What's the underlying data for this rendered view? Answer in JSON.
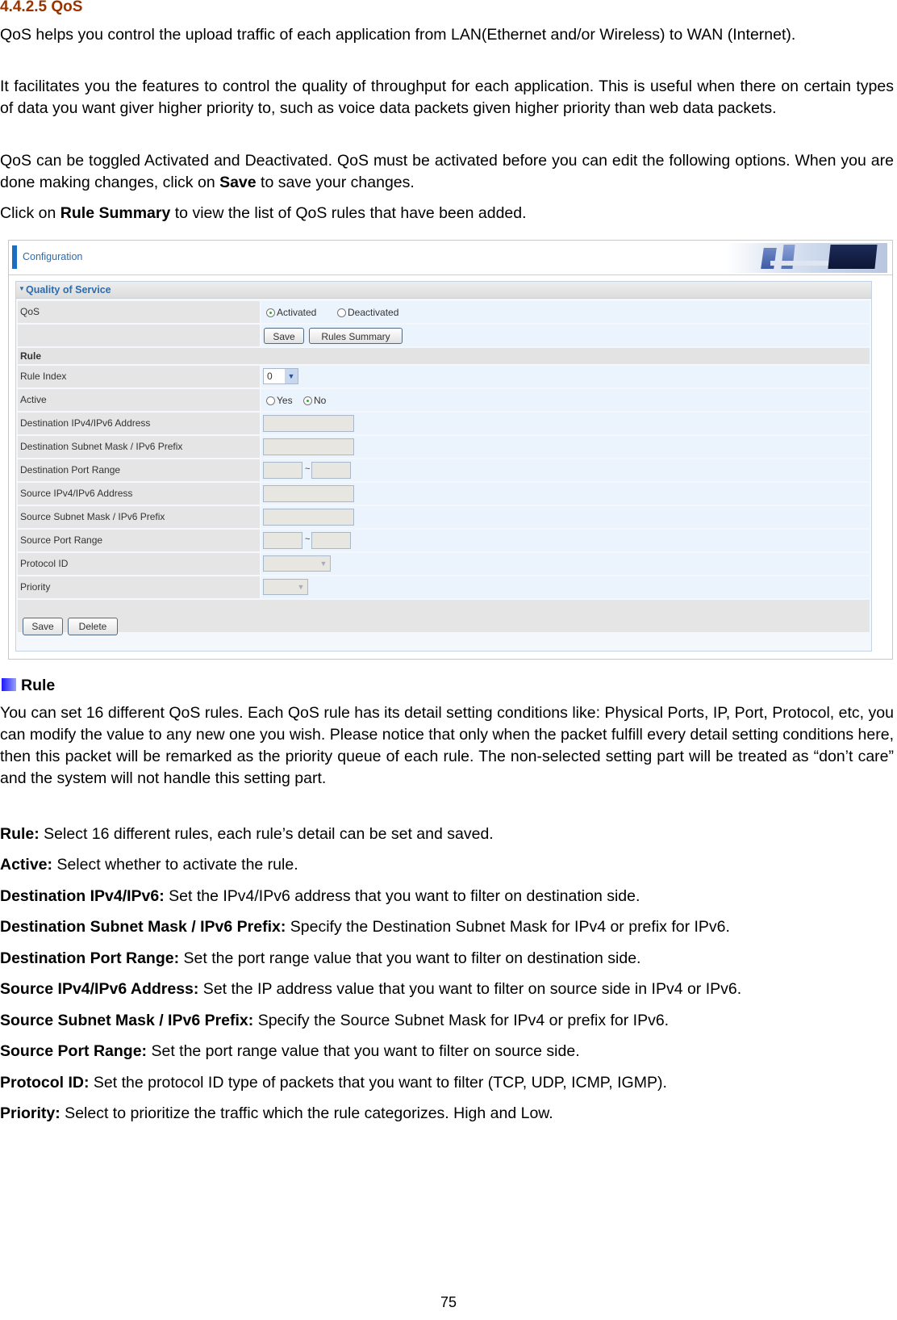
{
  "section": {
    "heading": "4.4.2.5 QoS",
    "paragraphs": [
      "QoS helps you control the upload traffic of each application from LAN(Ethernet and/or Wireless) to WAN (Internet).",
      "It facilitates you the features to control the quality of throughput for each application. This is useful when there on certain types of data you want giver higher priority to, such as voice data packets given higher priority than web data packets."
    ],
    "toggle_para": {
      "pre": "QoS can be toggled Activated and Deactivated. QoS must be activated before you can edit the following options. When you are done making changes, click on ",
      "bold": "Save",
      "post": " to save your changes."
    },
    "summary_para": {
      "pre": "Click on ",
      "bold": "Rule Summary",
      "post": " to view the list of QoS rules that have been added."
    }
  },
  "ui": {
    "header_title": "Configuration",
    "banner_icon": "office-banner-image",
    "panel_title": "Quality of Service",
    "qos": {
      "label": "QoS",
      "options": [
        "Activated",
        "Deactivated"
      ],
      "selected": "Activated",
      "save_label": "Save",
      "rules_summary_label": "Rules Summary"
    },
    "rule_section_label": "Rule",
    "rule_index": {
      "label": "Rule Index",
      "value": "0"
    },
    "active": {
      "label": "Active",
      "options": [
        "Yes",
        "No"
      ],
      "selected": "No"
    },
    "fields": {
      "dest_addr": {
        "label": "Destination IPv4/IPv6 Address",
        "value": ""
      },
      "dest_mask": {
        "label": "Destination Subnet Mask / IPv6 Prefix",
        "value": ""
      },
      "dest_port": {
        "label": "Destination Port Range",
        "from": "",
        "to": "",
        "sep": "~"
      },
      "src_addr": {
        "label": "Source IPv4/IPv6 Address",
        "value": ""
      },
      "src_mask": {
        "label": "Source Subnet Mask / IPv6 Prefix",
        "value": ""
      },
      "src_port": {
        "label": "Source Port Range",
        "from": "",
        "to": "",
        "sep": "~"
      },
      "protocol": {
        "label": "Protocol ID",
        "value": ""
      },
      "priority": {
        "label": "Priority",
        "value": ""
      }
    },
    "footer": {
      "save_label": "Save",
      "delete_label": "Delete"
    }
  },
  "rule_section": {
    "heading": "Rule",
    "intro": "You can set 16 different QoS rules. Each QoS rule has its detail setting conditions like: Physical Ports, IP, Port, Protocol, etc, you can modify the value to any new one you wish. Please notice that only when the packet fulfill every detail setting conditions here, then this packet will be remarked as the priority queue of each rule. The non-selected setting part will be treated as “don’t care” and the system will not handle this setting part.",
    "definitions": [
      {
        "term": "Rule:",
        "desc": " Select 16 different rules, each rule’s detail can be set and saved."
      },
      {
        "term": "Active:",
        "desc": " Select whether to activate the rule."
      },
      {
        "term": "Destination IPv4/IPv6:",
        "desc": " Set the IPv4/IPv6 address that you want to filter on destination side."
      },
      {
        "term": "Destination Subnet Mask / IPv6 Prefix:",
        "desc": " Specify the Destination Subnet Mask for IPv4 or prefix for IPv6."
      },
      {
        "term": "Destination Port Range:",
        "desc": " Set the port range value that you want to filter on destination side."
      },
      {
        "term": "Source IPv4/IPv6 Address:",
        "desc": " Set the IP address value that you want to filter on source side in IPv4 or IPv6."
      },
      {
        "term": "Source Subnet Mask / IPv6 Prefix:",
        "desc": " Specify the Source Subnet Mask for IPv4 or prefix for IPv6."
      },
      {
        "term": "Source Port Range:",
        "desc": " Set the port range value that you want to filter on source side."
      },
      {
        "term": "Protocol ID:",
        "desc": " Set the protocol ID type of packets that you want to filter (TCP, UDP, ICMP, IGMP)."
      },
      {
        "term": "Priority:",
        "desc": " Select to prioritize the traffic which the rule categorizes. High and Low."
      }
    ]
  },
  "page_number": "75"
}
